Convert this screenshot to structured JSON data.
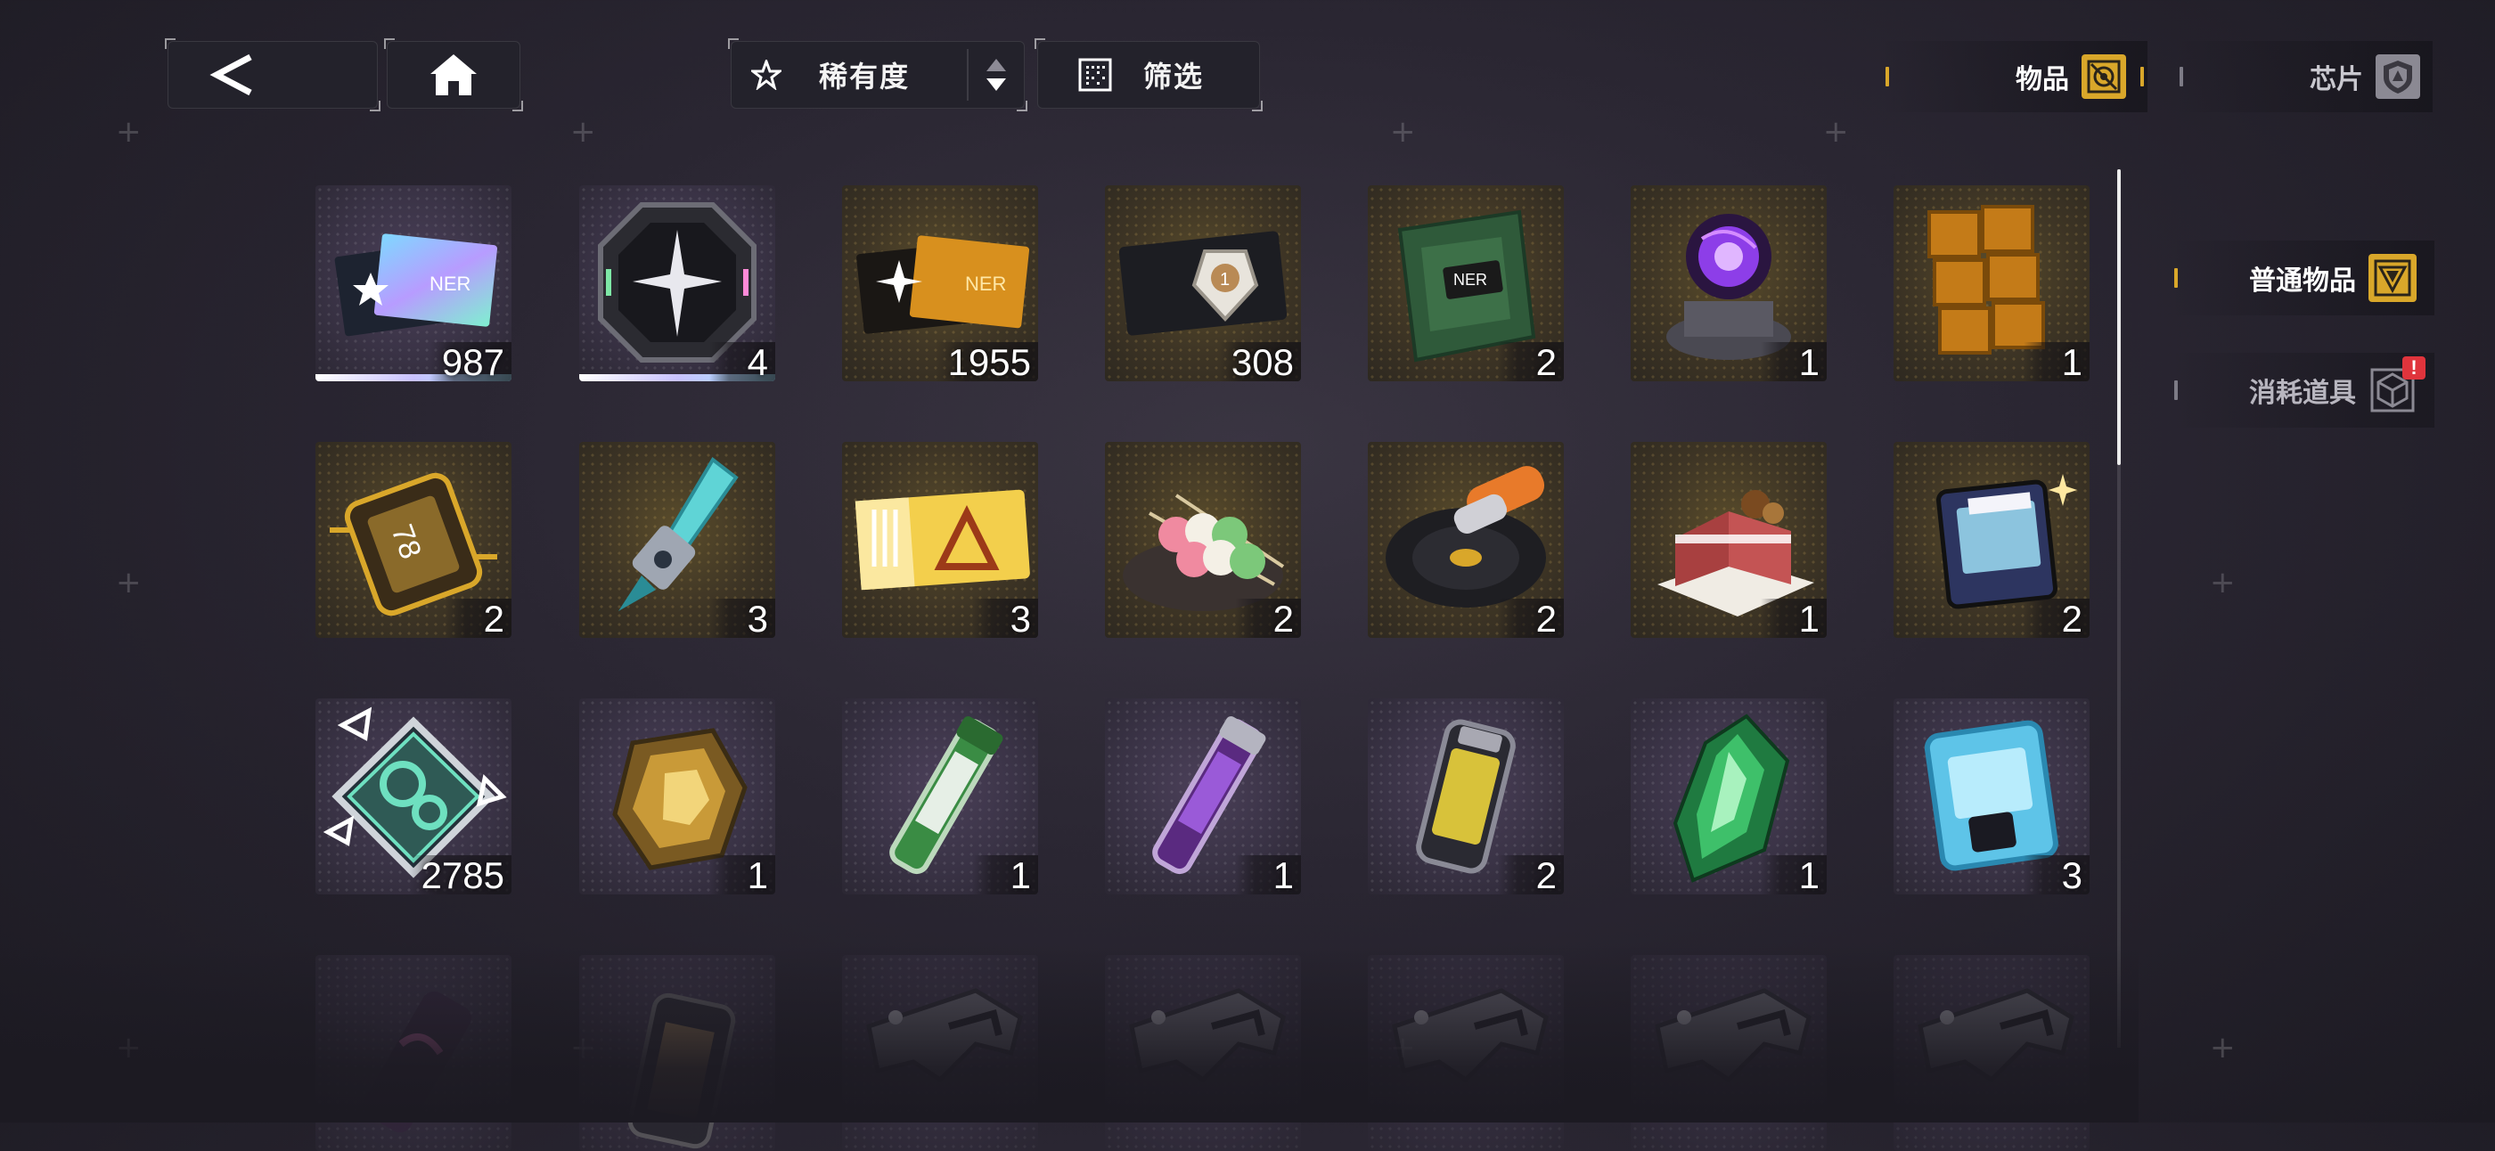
{
  "topbar": {
    "sort_label": "稀有度",
    "filter_label": "筛选"
  },
  "tabs": {
    "items_label": "物品",
    "chips_label": "芯片"
  },
  "side": {
    "normal_label": "普通物品",
    "consumable_label": "消耗道具",
    "consumable_alert": "!"
  },
  "inventory": {
    "rows": [
      [
        {
          "icon": "holo-ticket-icon",
          "count": "987",
          "rarity": "purple"
        },
        {
          "icon": "octagon-emblem-icon",
          "count": "4",
          "rarity": "purple"
        },
        {
          "icon": "gold-ticket-icon",
          "count": "1955",
          "rarity": "gold"
        },
        {
          "icon": "black-card-icon",
          "count": "308",
          "rarity": "gold"
        },
        {
          "icon": "snack-bag-icon",
          "count": "2",
          "rarity": "gold"
        },
        {
          "icon": "plasma-orb-icon",
          "count": "1",
          "rarity": "gold"
        },
        {
          "icon": "gold-blocks-icon",
          "count": "1",
          "rarity": "gold"
        }
      ],
      [
        {
          "icon": "capsule-device-icon",
          "count": "2",
          "rarity": "gold"
        },
        {
          "icon": "crystal-drill-icon",
          "count": "3",
          "rarity": "gold"
        },
        {
          "icon": "yellow-pass-icon",
          "count": "3",
          "rarity": "gold"
        },
        {
          "icon": "dango-plate-icon",
          "count": "2",
          "rarity": "gold"
        },
        {
          "icon": "vinyl-record-icon",
          "count": "2",
          "rarity": "gold"
        },
        {
          "icon": "cake-icon",
          "count": "1",
          "rarity": "gold"
        },
        {
          "icon": "game-cartridge-icon",
          "count": "2",
          "rarity": "gold"
        }
      ],
      [
        {
          "icon": "gear-module-icon",
          "count": "2785",
          "rarity": "purple"
        },
        {
          "icon": "gold-ore-icon",
          "count": "1",
          "rarity": "purple"
        },
        {
          "icon": "green-vial-icon",
          "count": "1",
          "rarity": "purple"
        },
        {
          "icon": "purple-vial-icon",
          "count": "1",
          "rarity": "purple"
        },
        {
          "icon": "battery-icon",
          "count": "2",
          "rarity": "purple"
        },
        {
          "icon": "green-crystal-icon",
          "count": "1",
          "rarity": "purple"
        },
        {
          "icon": "ice-box-icon",
          "count": "3",
          "rarity": "purple"
        }
      ],
      [
        {
          "icon": "pink-canister-icon",
          "count": "",
          "rarity": "purple"
        },
        {
          "icon": "dark-cylinder-icon",
          "count": "",
          "rarity": "purple"
        },
        {
          "icon": "weapon-part-icon",
          "count": "",
          "rarity": "purple"
        },
        {
          "icon": "weapon-part-icon",
          "count": "",
          "rarity": "purple"
        },
        {
          "icon": "weapon-part-icon",
          "count": "",
          "rarity": "purple"
        },
        {
          "icon": "weapon-part-icon",
          "count": "",
          "rarity": "purple"
        },
        {
          "icon": "weapon-part-icon",
          "count": "",
          "rarity": "purple"
        }
      ]
    ]
  },
  "colors": {
    "accent_gold": "#d9a72a",
    "alert_red": "#e0343c"
  }
}
